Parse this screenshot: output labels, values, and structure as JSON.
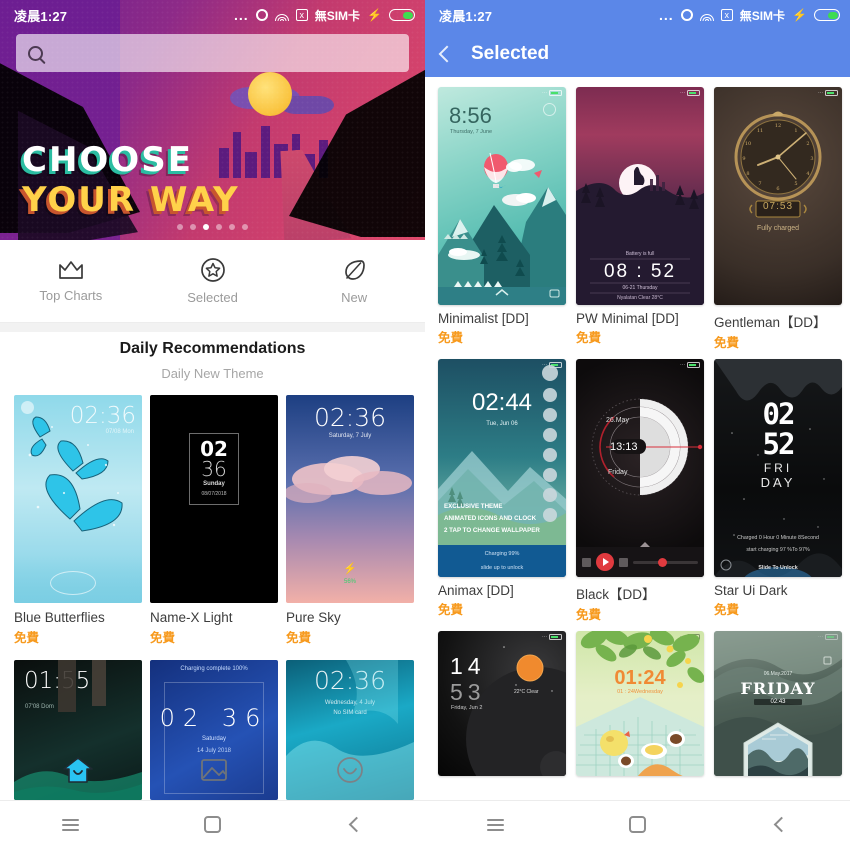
{
  "statusbar": {
    "time": "凌晨1:27",
    "dots": "...",
    "sim_label": "無SIM卡",
    "icons": [
      "more-dots-icon",
      "circle-icon",
      "wifi-icon",
      "no-signal-icon",
      "charging-bolt-icon",
      "battery-icon"
    ]
  },
  "left_phone": {
    "search": {
      "placeholder": "",
      "value": "",
      "icon": "search-icon"
    },
    "hero": {
      "line1": "CHOOSE",
      "line2": "YOUR WAY",
      "dot_count": 6,
      "active_dot": 3
    },
    "tabs": [
      {
        "label": "Top Charts",
        "icon": "crown-icon",
        "active": false
      },
      {
        "label": "Selected",
        "icon": "star-circle-icon",
        "active": false
      },
      {
        "label": "New",
        "icon": "leaf-icon",
        "active": false
      }
    ],
    "section": {
      "title": "Daily Recommendations",
      "subtitle": "Daily New Theme"
    },
    "themes_row1": [
      {
        "name": "Blue Butterflies",
        "price": "免費",
        "clock": "02:36",
        "sub": "07/08 Mon"
      },
      {
        "name": "Name-X Light",
        "price": "免費",
        "clock": "02",
        "clock2": "36",
        "sub": "Sunday",
        "sub2": "08/07/2018"
      },
      {
        "name": "Pure Sky",
        "price": "免費",
        "clock": "02:36",
        "sub": "Saturday, 7 July",
        "battery": "56%"
      }
    ],
    "themes_row2": [
      {
        "clock": "01:55",
        "sub": "07'08 Dom"
      },
      {
        "clock_h": "02",
        "clock_m": "36",
        "sub": "Saturday",
        "sub2": "14 July 2018",
        "top": "Charging complete 100%"
      },
      {
        "clock": "02:36",
        "sub": "Wednesday, 4 July",
        "sub2": "No SIM card"
      }
    ],
    "overlay_icons": [
      "home-icon",
      "image-icon",
      "smiley-icon"
    ],
    "navbar": [
      {
        "icon": "menu-icon"
      },
      {
        "icon": "home-square-icon"
      },
      {
        "icon": "back-chevron-icon"
      }
    ]
  },
  "right_phone": {
    "appbar": {
      "back_icon": "back-chevron-icon",
      "title": "Selected"
    },
    "themes": [
      {
        "name": "Minimalist [DD]",
        "price": "免費",
        "clock": "8:56",
        "sub": "Thursday, 7 June"
      },
      {
        "name": "PW Minimal [DD]",
        "price": "免費",
        "clock": "08 : 52",
        "top": "Battery is full",
        "sub": "06-21 Thursday",
        "sub2": "Nyalatan Clear 28°C"
      },
      {
        "name": "Gentleman【DD】",
        "price": "免費",
        "clock": "07:53",
        "sub": "Fully charged"
      },
      {
        "name": "Animax [DD]",
        "price": "免費",
        "clock": "02:44",
        "sub": "Tue, Jun 06",
        "note1": "EXCLUSIVE THEME",
        "note2": "ANIMATED ICONS AND CLOCK",
        "note3": "2 TAP TO CHANGE WALLPAPER",
        "note4": "Charging 99%",
        "note5": "slide up to unlock"
      },
      {
        "name": "Black【DD】",
        "price": "免費",
        "date": "26.May",
        "clock": "13:13",
        "day": "Friday"
      },
      {
        "name": "Star Ui Dark",
        "price": "免費",
        "clock_a": "02",
        "clock_b": "52",
        "word1": "FRI",
        "word2": "DAY",
        "note1": "Charged 0 Hour 0 Minute 8Second",
        "note2": "start charging 97 %To 97%",
        "note3": "Slide To Unlock"
      },
      {
        "name": "",
        "price": "",
        "clock_h": "14",
        "clock_m": "53",
        "sub": "Friday, Jun 2",
        "weather": "22°C Clear"
      },
      {
        "name": "",
        "price": "",
        "clock": "01:24",
        "sub": "01 : 24Wednesday"
      },
      {
        "name": "",
        "price": "",
        "date": "06.May.2017",
        "word": "FRIDAY",
        "clock": "02:43"
      }
    ],
    "navbar": [
      {
        "icon": "menu-icon"
      },
      {
        "icon": "home-square-icon"
      },
      {
        "icon": "back-chevron-icon"
      }
    ]
  },
  "colors": {
    "accent_blue": "#5b87e8",
    "price_orange": "#f79a1e",
    "battery_green": "#3ddc50"
  }
}
